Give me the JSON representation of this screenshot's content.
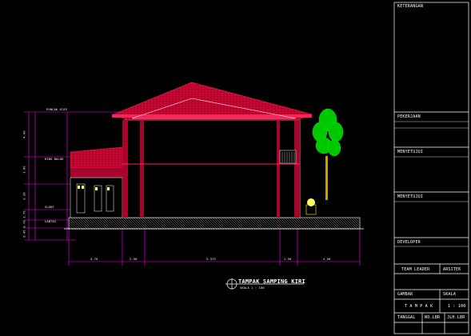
{
  "title_block": {
    "keterangan": "KETERANGAN",
    "pekerjaan": "PEKERJAAN",
    "menyetujui_header": "MENYETUJUI",
    "menyetujui": "MENYETUJUI",
    "developer": "DEVELOPER",
    "team_leader": "TEAM LEADER",
    "arsitek": "ARSITEK",
    "gambar_label": "GAMBAR",
    "skala_label": "SKALA",
    "gambar_value": "T A M P A K",
    "skala_value": "1 : 100",
    "tanggal": "TANGGAL",
    "no_lbr": "NO.LBR",
    "jlh_lbr": "JLH.LBR"
  },
  "drawing": {
    "title": "TAMPAK SAMPING KIRI",
    "scale": "SKALA   1 : 100",
    "dim_bottom": [
      "4.70",
      "2.50",
      "5.375",
      "1.50",
      "4.50"
    ],
    "dim_left": [
      "4.00",
      "1.80",
      "2.30",
      "1.70",
      "0.70",
      "0.45"
    ],
    "level_labels": [
      "PUNCAK ATAP",
      "RING BALOK",
      "SLOOF",
      "LANTAI"
    ]
  },
  "colors": {
    "background": "#000000",
    "roof": "#c80032",
    "frame": "#ff00ff",
    "dimension": "#ff00ff",
    "tree": "#00c800",
    "wall_line": "#ffffff"
  }
}
